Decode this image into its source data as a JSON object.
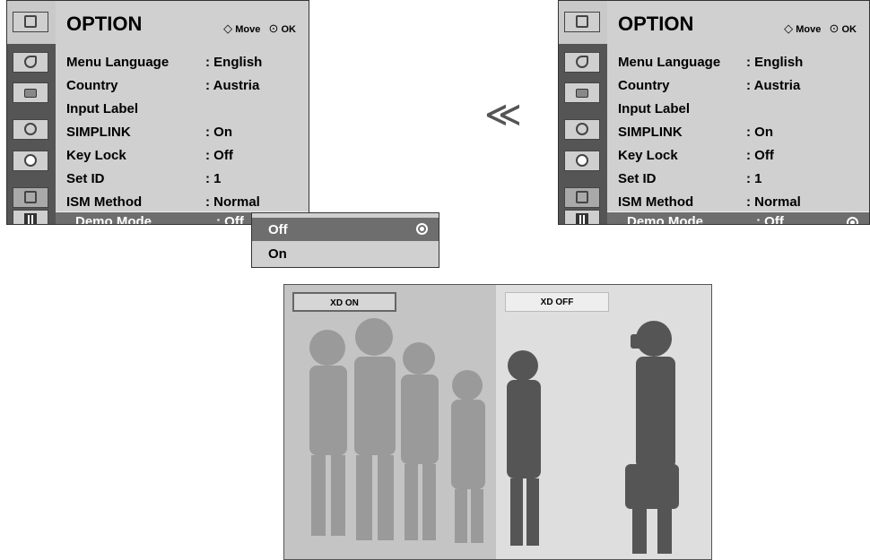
{
  "menu": {
    "title": "OPTION",
    "hint_move_glyph": "◇",
    "hint_move": "Move",
    "hint_ok_glyph": "⊙",
    "hint_ok": "OK",
    "items": [
      {
        "label": "Menu Language",
        "value": ": English"
      },
      {
        "label": "Country",
        "value": ": Austria"
      },
      {
        "label": "Input Label",
        "value": ""
      },
      {
        "label": "SIMPLINK",
        "value": ": On"
      },
      {
        "label": "Key Lock",
        "value": ": Off"
      },
      {
        "label": "Set ID",
        "value": ": 1"
      },
      {
        "label": "ISM Method",
        "value": ": Normal"
      },
      {
        "label": "Demo Mode",
        "value": ": Off"
      }
    ],
    "sidebar_icons": [
      "satellite-icon",
      "picture-icon",
      "audio-icon",
      "clock-icon",
      "option-icon",
      "film-icon"
    ]
  },
  "popup": {
    "options": [
      "Off",
      "On"
    ],
    "selected": "Off"
  },
  "scroll_arrow": "▼",
  "transition": "≪",
  "demo": {
    "xd_on": "XD ON",
    "xd_off": "XD OFF"
  }
}
